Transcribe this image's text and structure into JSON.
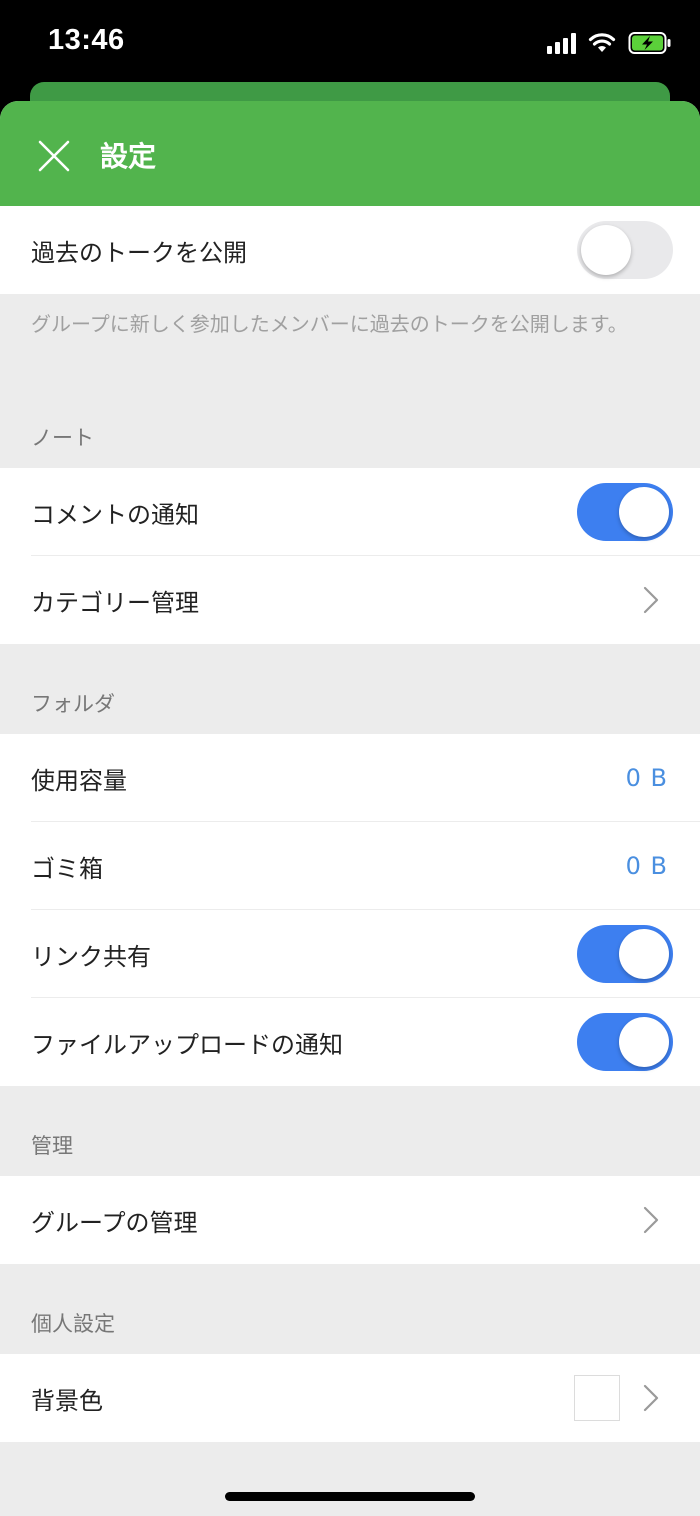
{
  "status_bar": {
    "time": "13:46"
  },
  "header": {
    "title": "設定"
  },
  "talk_history": {
    "label": "過去のトークを公開",
    "toggle_on": false,
    "description": "グループに新しく参加したメンバーに過去のトークを公開します。"
  },
  "note_section": {
    "title": "ノート",
    "comment_notify_label": "コメントの通知",
    "comment_notify_on": true,
    "category_label": "カテゴリー管理"
  },
  "folder_section": {
    "title": "フォルダ",
    "usage_label": "使用容量",
    "usage_value": "0 B",
    "trash_label": "ゴミ箱",
    "trash_value": "0 B",
    "link_share_label": "リンク共有",
    "link_share_on": true,
    "upload_notify_label": "ファイルアップロードの通知",
    "upload_notify_on": true
  },
  "manage_section": {
    "title": "管理",
    "group_manage_label": "グループの管理"
  },
  "personal_section": {
    "title": "個人設定",
    "bg_color_label": "背景色",
    "bg_color_value": "#ffffff"
  },
  "colors": {
    "header_green": "#52b44d",
    "toggle_blue": "#3d7ff0",
    "value_blue": "#4a8fe0"
  }
}
